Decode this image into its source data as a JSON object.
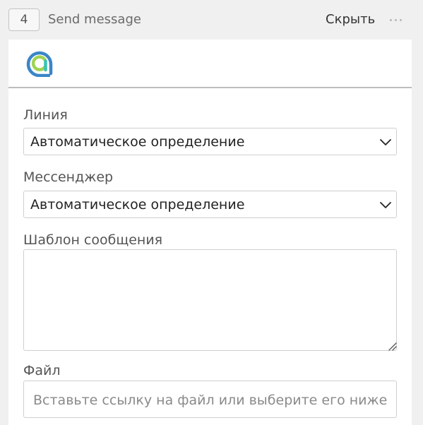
{
  "header": {
    "step_number": "4",
    "title": "Send message",
    "hide_label": "Скрыть",
    "more_icon": "more-horizontal-icon"
  },
  "logo": {
    "icon": "messaging-app-logo-icon",
    "colors": [
      "#3a86c8",
      "#9fd354",
      "#3ac3b3"
    ]
  },
  "form": {
    "line": {
      "label": "Линия",
      "value": "Автоматическое определение",
      "icon": "chevron-down-icon"
    },
    "messenger": {
      "label": "Мессенджер",
      "value": "Автоматическое определение",
      "icon": "chevron-down-icon"
    },
    "template": {
      "label": "Шаблон сообщения",
      "value": ""
    },
    "file": {
      "label": "Файл",
      "placeholder": "Вставьте ссылку на файл или выберите его ниже",
      "value": ""
    }
  }
}
